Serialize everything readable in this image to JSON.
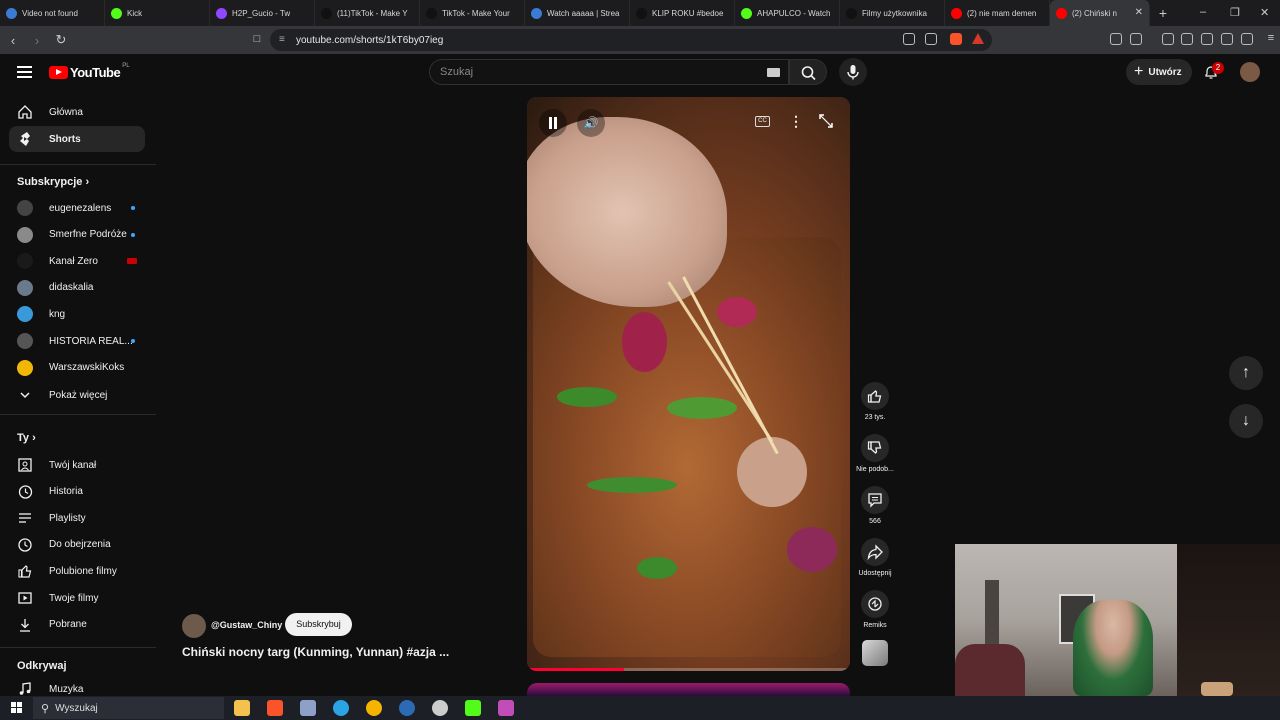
{
  "browser": {
    "tabs": [
      {
        "label": "Video not found",
        "color": "#3a7bd5"
      },
      {
        "label": "Kick",
        "color": "#53fc18"
      },
      {
        "label": "H2P_Gucio - Tw",
        "color": "#9146ff"
      },
      {
        "label": "(11)TikTok - Make Y",
        "color": "#111111"
      },
      {
        "label": "TikTok - Make Your",
        "color": "#111111"
      },
      {
        "label": "Watch aaaaa | Strea",
        "color": "#3a7bd5"
      },
      {
        "label": "KLIP ROKU #bedoe",
        "color": "#111111"
      },
      {
        "label": "AHAPULCO - Watch",
        "color": "#53fc18"
      },
      {
        "label": "Filmy użytkownika",
        "color": "#111111"
      },
      {
        "label": "(2) nie mam demen",
        "color": "#ff0000"
      },
      {
        "label": "(2) Chiński n",
        "color": "#ff0000",
        "active": true
      }
    ],
    "url": "youtube.com/shorts/1kT6by07ieg"
  },
  "youtube": {
    "logo_text": "YouTube",
    "region": "PL",
    "search_placeholder": "Szukaj",
    "create_label": "Utwórz",
    "notification_count": "2"
  },
  "sidebar": {
    "main": [
      {
        "label": "Główna",
        "icon": "home-icon"
      },
      {
        "label": "Shorts",
        "icon": "shorts-icon",
        "active": true
      }
    ],
    "subscriptions_header": "Subskrypcje",
    "subscriptions": [
      {
        "label": "eugenezalens",
        "indicator": "dot",
        "color": "#444444"
      },
      {
        "label": "Smerfne Podróże",
        "indicator": "dot",
        "color": "#8a8a8a"
      },
      {
        "label": "Kanał Zero",
        "indicator": "live",
        "color": "#1a1a1a"
      },
      {
        "label": "didaskalia",
        "indicator": "none",
        "color": "#6a7a8a"
      },
      {
        "label": "kng",
        "indicator": "none",
        "color": "#3a9ad9"
      },
      {
        "label": "HISTORIA REAL...",
        "indicator": "dot",
        "color": "#555555"
      },
      {
        "label": "WarszawskiKoks",
        "indicator": "none",
        "color": "#f2b705"
      }
    ],
    "show_more": "Pokaż więcej",
    "you_header": "Ty",
    "you": [
      {
        "label": "Twój kanał",
        "icon": "channel-icon"
      },
      {
        "label": "Historia",
        "icon": "history-icon"
      },
      {
        "label": "Playlisty",
        "icon": "playlist-icon"
      },
      {
        "label": "Do obejrzenia",
        "icon": "watch-later-icon"
      },
      {
        "label": "Polubione filmy",
        "icon": "like-icon"
      },
      {
        "label": "Twoje filmy",
        "icon": "video-icon"
      },
      {
        "label": "Pobrane",
        "icon": "download-icon"
      }
    ],
    "explore_header": "Odkrywaj",
    "explore": [
      {
        "label": "Muzyka",
        "icon": "music-icon"
      }
    ]
  },
  "short": {
    "channel": "@Gustaw_Chiny",
    "subscribe": "Subskrybuj",
    "title": "Chiński nocny targ (Kunming, Yunnan)  #azja ...",
    "progress_fraction": 0.3
  },
  "actions": {
    "likes": "23 tys.",
    "dislike": "Nie podob...",
    "comments": "566",
    "share": "Udostępnij",
    "remix": "Remiks"
  },
  "taskbar": {
    "search_label": "Wyszukaj",
    "apps": [
      {
        "name": "file-explorer-icon",
        "color": "#f2c14e"
      },
      {
        "name": "brave-icon",
        "color": "#fb542b"
      },
      {
        "name": "app-icon",
        "color": "#8ca0c8"
      },
      {
        "name": "edge-icon",
        "color": "#2aa4e2"
      },
      {
        "name": "chrome-icon",
        "color": "#f4b400"
      },
      {
        "name": "steam-icon",
        "color": "#2a6bb4"
      },
      {
        "name": "obs-icon",
        "color": "#cccccc"
      },
      {
        "name": "kick-icon",
        "color": "#53fc18"
      },
      {
        "name": "game-icon",
        "color": "#c34db8"
      }
    ]
  }
}
